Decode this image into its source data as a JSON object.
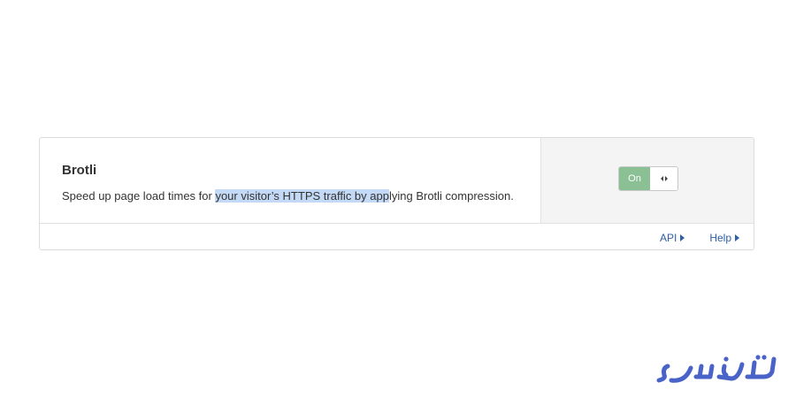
{
  "setting": {
    "title": "Brotli",
    "description": {
      "before": "Speed up page load times for ",
      "selected": "your visitor’s HTTPS traffic by app",
      "after": "lying Brotli compression."
    },
    "toggle": {
      "state_label": "On",
      "knob_icon": "code-arrows-icon",
      "on_color": "#8ac093"
    }
  },
  "footer": {
    "api_label": "API",
    "help_label": "Help",
    "link_color": "#2c5fa8"
  },
  "watermark": {
    "text": "ایران سرور",
    "color": "#4a63c9"
  }
}
